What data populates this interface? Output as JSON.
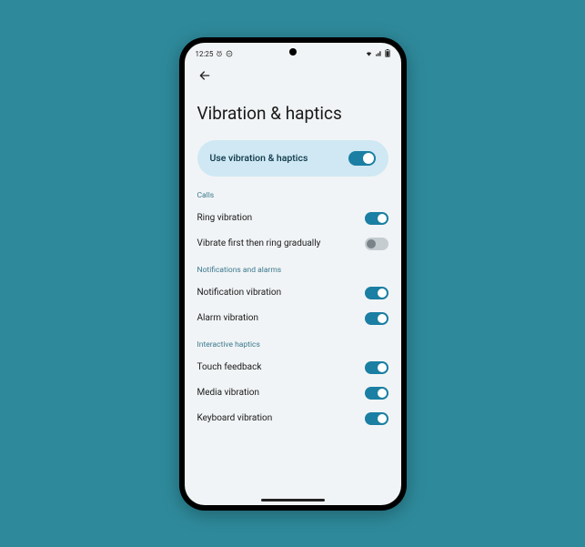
{
  "statusbar": {
    "time": "12:25",
    "signal_icon": "signal",
    "battery_icon": "battery"
  },
  "page": {
    "title": "Vibration & haptics"
  },
  "hero": {
    "label": "Use vibration & haptics",
    "on": true
  },
  "sections": [
    {
      "header": "Calls",
      "items": [
        {
          "label": "Ring vibration",
          "on": true
        },
        {
          "label": "Vibrate first then ring gradually",
          "on": false
        }
      ]
    },
    {
      "header": "Notifications and alarms",
      "items": [
        {
          "label": "Notification vibration",
          "on": true
        },
        {
          "label": "Alarm vibration",
          "on": true
        }
      ]
    },
    {
      "header": "Interactive haptics",
      "items": [
        {
          "label": "Touch feedback",
          "on": true
        },
        {
          "label": "Media vibration",
          "on": true
        },
        {
          "label": "Keyboard vibration",
          "on": true
        }
      ]
    }
  ]
}
